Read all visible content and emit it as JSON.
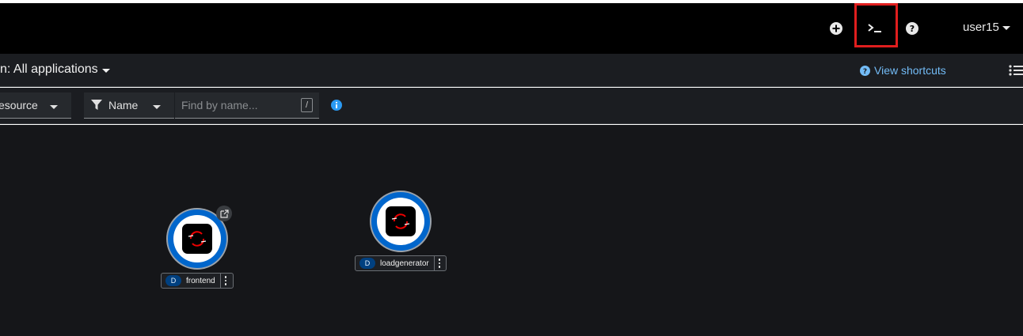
{
  "masthead": {
    "icons": [
      "plus-circle-icon",
      "terminal-icon",
      "question-circle-icon"
    ],
    "user": "user15"
  },
  "appbar": {
    "application_selector": "n: All applications",
    "shortcuts_label": "View shortcuts",
    "list_view_icon": "list-icon"
  },
  "filterbar": {
    "resource_filter": "esource",
    "name_filter": "Name",
    "search_placeholder": "Find by name...",
    "shortcut_key": "/"
  },
  "topology": {
    "nodes": [
      {
        "badge": "D",
        "name": "frontend",
        "has_external_link": true
      },
      {
        "badge": "D",
        "name": "loadgenerator",
        "has_external_link": false
      }
    ]
  },
  "colors": {
    "highlight_box": "#e01e1e",
    "link": "#73bcf7",
    "pod_ring": "#0066cc",
    "badge_bg": "#004080"
  }
}
